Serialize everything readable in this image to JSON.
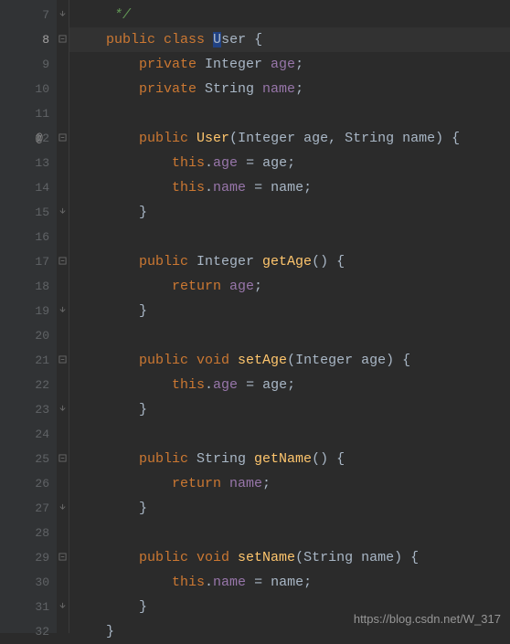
{
  "active_line": 8,
  "watermark": "https://blog.csdn.net/W_317",
  "lines": [
    {
      "num": 7,
      "fold": "close",
      "tokens": [
        [
          "comment",
          "     */"
        ]
      ]
    },
    {
      "num": 8,
      "fold": "open",
      "active": true,
      "tokens": [
        [
          "kw",
          "    public "
        ],
        [
          "kw",
          "class "
        ],
        [
          "sel",
          "U"
        ],
        [
          "ident",
          "ser "
        ],
        [
          "brace",
          "{"
        ]
      ]
    },
    {
      "num": 9,
      "tokens": [
        [
          "kw",
          "        private "
        ],
        [
          "type",
          "Integer "
        ],
        [
          "field",
          "age"
        ],
        [
          "punct",
          ";"
        ]
      ]
    },
    {
      "num": 10,
      "tokens": [
        [
          "kw",
          "        private "
        ],
        [
          "type",
          "String "
        ],
        [
          "field",
          "name"
        ],
        [
          "punct",
          ";"
        ]
      ]
    },
    {
      "num": 11,
      "tokens": []
    },
    {
      "num": 12,
      "fold": "open",
      "annot": "@",
      "tokens": [
        [
          "kw",
          "        public "
        ],
        [
          "method",
          "User"
        ],
        [
          "punct",
          "("
        ],
        [
          "type",
          "Integer "
        ],
        [
          "ident",
          "age"
        ],
        [
          "punct",
          ", "
        ],
        [
          "type",
          "String "
        ],
        [
          "ident",
          "name"
        ],
        [
          "punct",
          ") "
        ],
        [
          "brace",
          "{"
        ]
      ]
    },
    {
      "num": 13,
      "tokens": [
        [
          "kw",
          "            this"
        ],
        [
          "punct",
          "."
        ],
        [
          "field",
          "age"
        ],
        [
          "op",
          " = "
        ],
        [
          "ident",
          "age"
        ],
        [
          "punct",
          ";"
        ]
      ]
    },
    {
      "num": 14,
      "tokens": [
        [
          "kw",
          "            this"
        ],
        [
          "punct",
          "."
        ],
        [
          "field",
          "name"
        ],
        [
          "op",
          " = "
        ],
        [
          "ident",
          "name"
        ],
        [
          "punct",
          ";"
        ]
      ]
    },
    {
      "num": 15,
      "fold": "close",
      "tokens": [
        [
          "brace",
          "        }"
        ]
      ]
    },
    {
      "num": 16,
      "tokens": []
    },
    {
      "num": 17,
      "fold": "open",
      "tokens": [
        [
          "kw",
          "        public "
        ],
        [
          "type",
          "Integer "
        ],
        [
          "method",
          "getAge"
        ],
        [
          "punct",
          "() "
        ],
        [
          "brace",
          "{"
        ]
      ]
    },
    {
      "num": 18,
      "tokens": [
        [
          "kw",
          "            return "
        ],
        [
          "field",
          "age"
        ],
        [
          "punct",
          ";"
        ]
      ]
    },
    {
      "num": 19,
      "fold": "close",
      "tokens": [
        [
          "brace",
          "        }"
        ]
      ]
    },
    {
      "num": 20,
      "tokens": []
    },
    {
      "num": 21,
      "fold": "open",
      "tokens": [
        [
          "kw",
          "        public "
        ],
        [
          "kw",
          "void "
        ],
        [
          "method",
          "setAge"
        ],
        [
          "punct",
          "("
        ],
        [
          "type",
          "Integer "
        ],
        [
          "ident",
          "age"
        ],
        [
          "punct",
          ") "
        ],
        [
          "brace",
          "{"
        ]
      ]
    },
    {
      "num": 22,
      "tokens": [
        [
          "kw",
          "            this"
        ],
        [
          "punct",
          "."
        ],
        [
          "field",
          "age"
        ],
        [
          "op",
          " = "
        ],
        [
          "ident",
          "age"
        ],
        [
          "punct",
          ";"
        ]
      ]
    },
    {
      "num": 23,
      "fold": "close",
      "tokens": [
        [
          "brace",
          "        }"
        ]
      ]
    },
    {
      "num": 24,
      "tokens": []
    },
    {
      "num": 25,
      "fold": "open",
      "tokens": [
        [
          "kw",
          "        public "
        ],
        [
          "type",
          "String "
        ],
        [
          "method",
          "getName"
        ],
        [
          "punct",
          "() "
        ],
        [
          "brace",
          "{"
        ]
      ]
    },
    {
      "num": 26,
      "tokens": [
        [
          "kw",
          "            return "
        ],
        [
          "field",
          "name"
        ],
        [
          "punct",
          ";"
        ]
      ]
    },
    {
      "num": 27,
      "fold": "close",
      "tokens": [
        [
          "brace",
          "        }"
        ]
      ]
    },
    {
      "num": 28,
      "tokens": []
    },
    {
      "num": 29,
      "fold": "open",
      "tokens": [
        [
          "kw",
          "        public "
        ],
        [
          "kw",
          "void "
        ],
        [
          "method",
          "setName"
        ],
        [
          "punct",
          "("
        ],
        [
          "type",
          "String "
        ],
        [
          "ident",
          "name"
        ],
        [
          "punct",
          ") "
        ],
        [
          "brace",
          "{"
        ]
      ]
    },
    {
      "num": 30,
      "tokens": [
        [
          "kw",
          "            this"
        ],
        [
          "punct",
          "."
        ],
        [
          "field",
          "name"
        ],
        [
          "op",
          " = "
        ],
        [
          "ident",
          "name"
        ],
        [
          "punct",
          ";"
        ]
      ]
    },
    {
      "num": 31,
      "fold": "close",
      "tokens": [
        [
          "brace",
          "        }"
        ]
      ]
    },
    {
      "num": 32,
      "tokens": [
        [
          "brace",
          "    }"
        ]
      ]
    }
  ]
}
